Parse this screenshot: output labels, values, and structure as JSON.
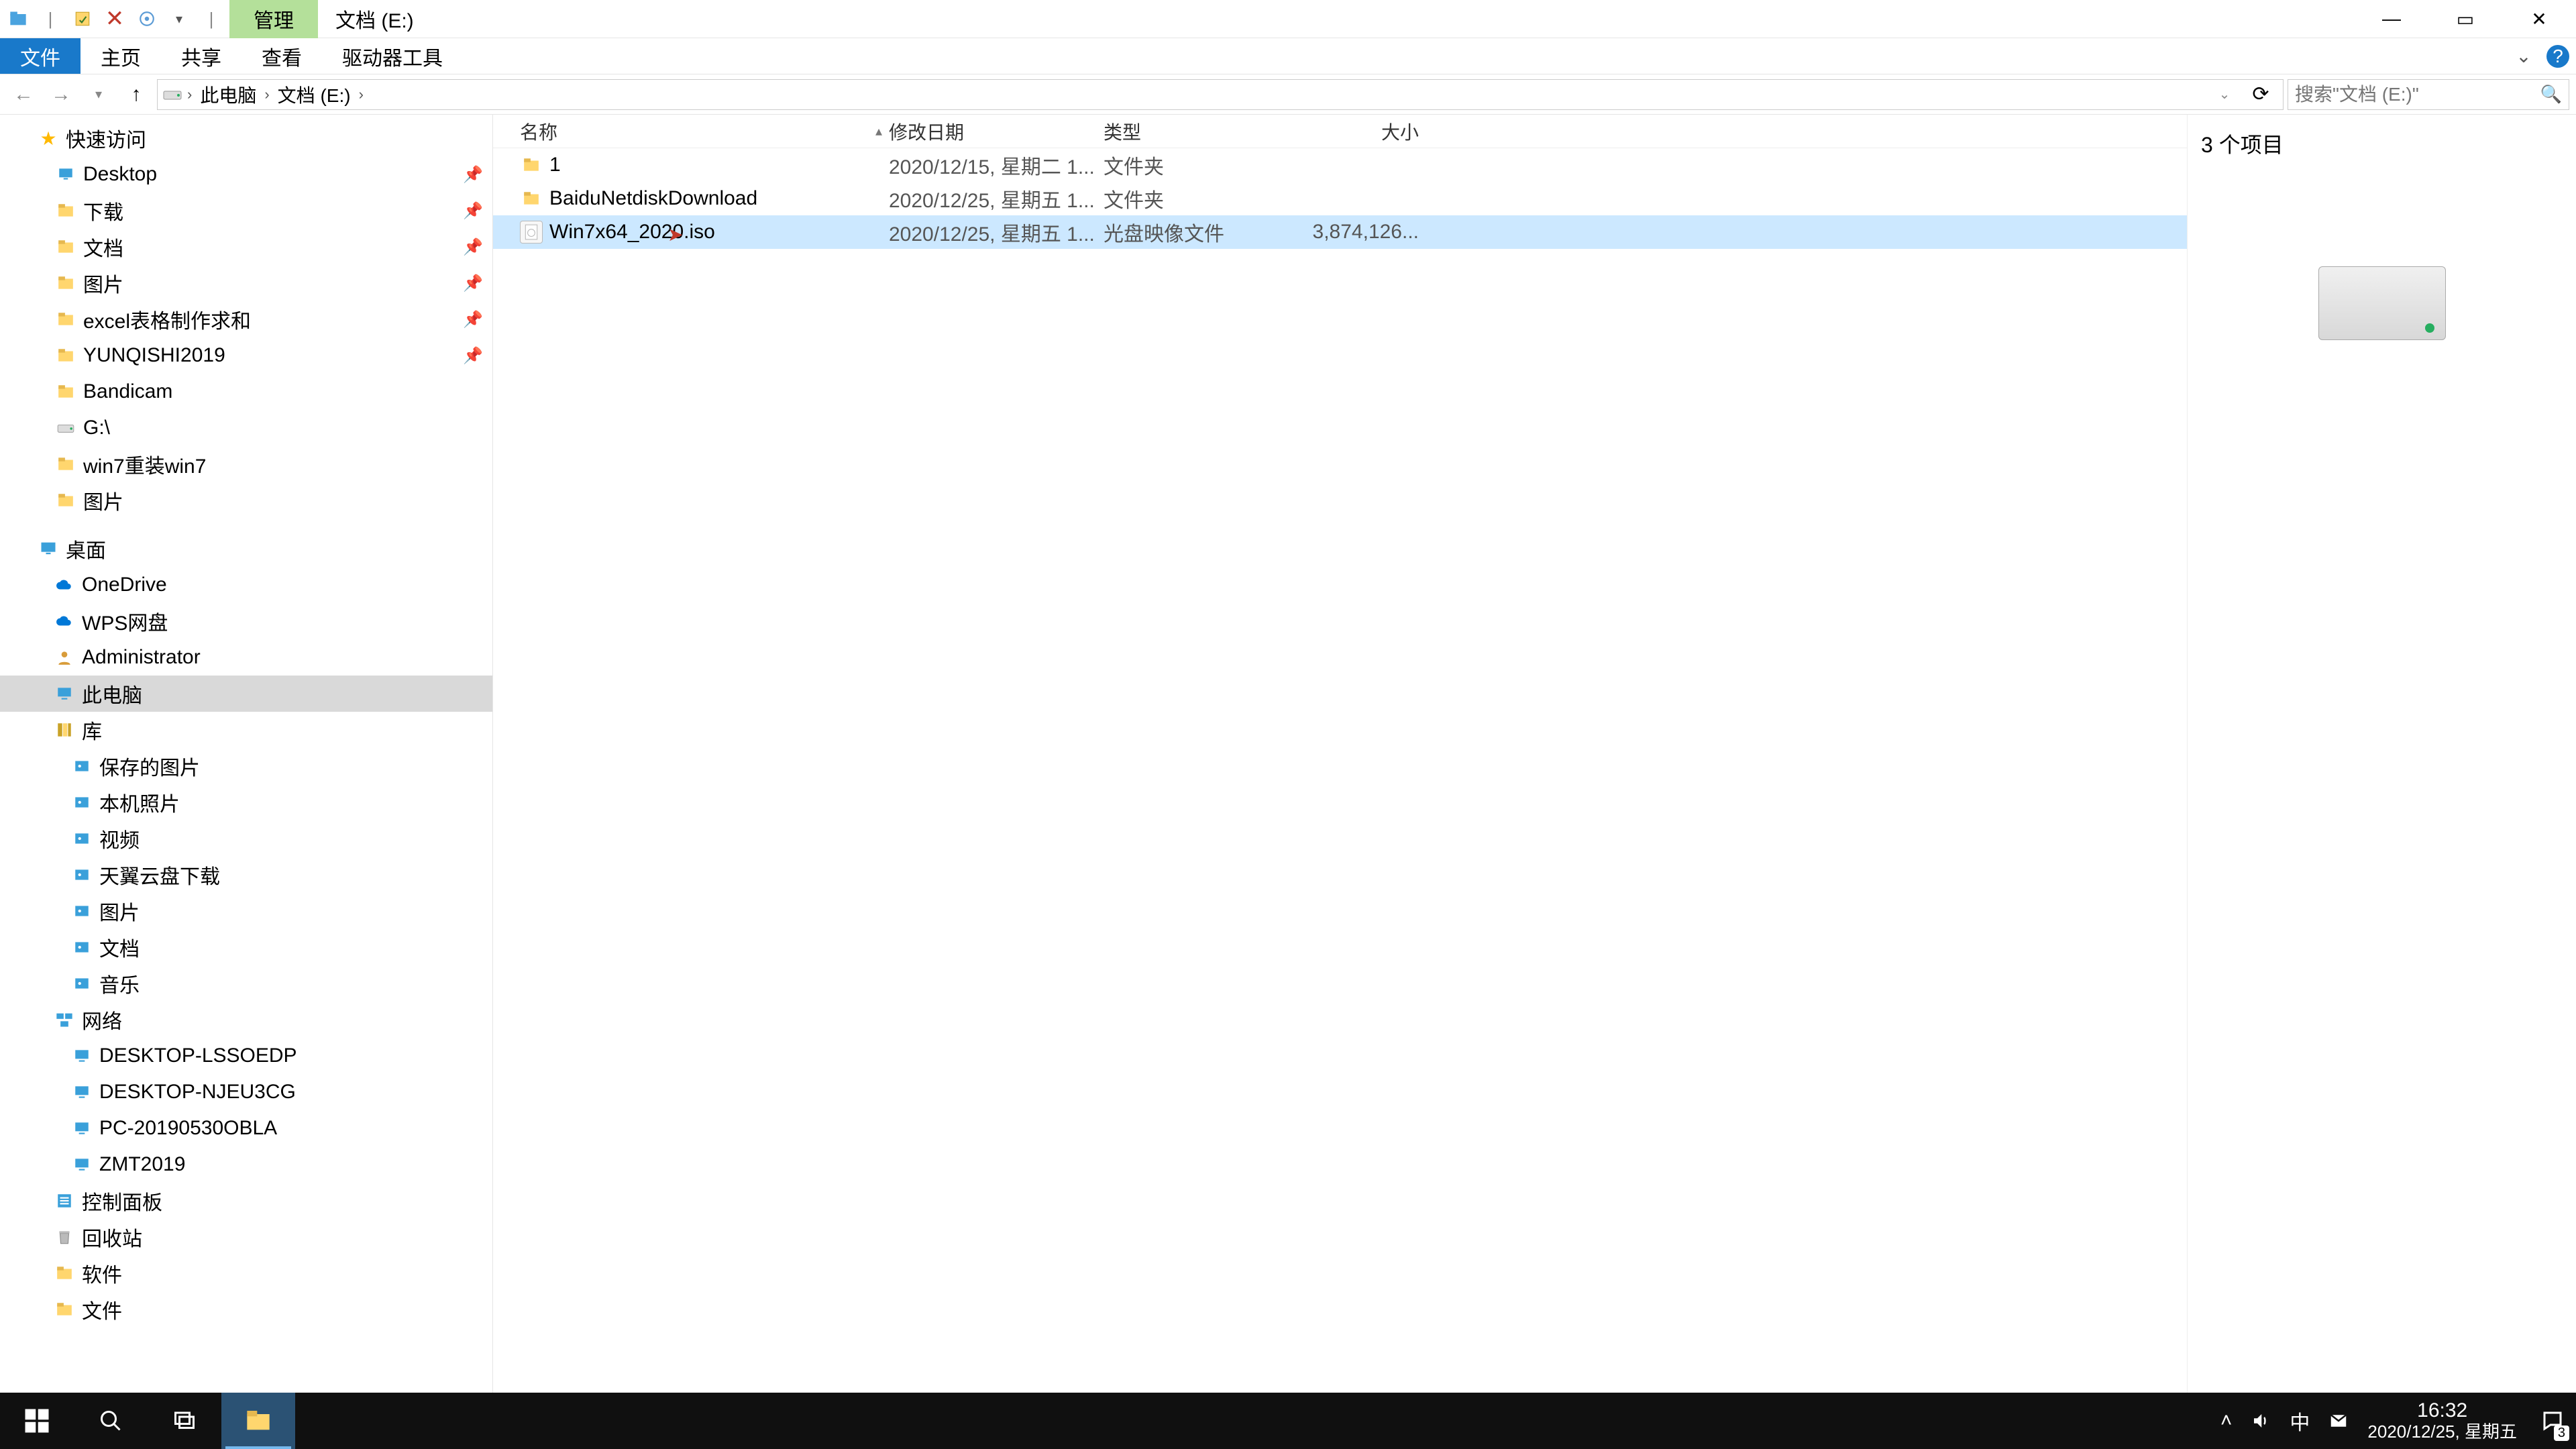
{
  "titlebar": {
    "contextual_tab": "管理",
    "title": "文档 (E:)"
  },
  "win_controls": {
    "min": "—",
    "max": "▭",
    "close": "✕"
  },
  "ribbon": {
    "file": "文件",
    "tabs": [
      "主页",
      "共享",
      "查看",
      "驱动器工具"
    ]
  },
  "addrbar": {
    "segments": [
      "此电脑",
      "文档 (E:)"
    ],
    "search_placeholder": "搜索\"文档 (E:)\""
  },
  "navtree": {
    "quick_access": "快速访问",
    "qa_items": [
      {
        "label": "Desktop",
        "icon": "desktop",
        "pinned": true
      },
      {
        "label": "下载",
        "icon": "folder",
        "pinned": true
      },
      {
        "label": "文档",
        "icon": "folder",
        "pinned": true
      },
      {
        "label": "图片",
        "icon": "folder",
        "pinned": true
      },
      {
        "label": "excel表格制作求和",
        "icon": "folder",
        "pinned": true
      },
      {
        "label": "YUNQISHI2019",
        "icon": "folder",
        "pinned": true
      },
      {
        "label": "Bandicam",
        "icon": "folder",
        "pinned": false
      },
      {
        "label": "G:\\",
        "icon": "drive",
        "pinned": false
      },
      {
        "label": "win7重装win7",
        "icon": "folder",
        "pinned": false
      },
      {
        "label": "图片",
        "icon": "folder",
        "pinned": false
      }
    ],
    "desktop": "桌面",
    "desktop_items": [
      {
        "label": "OneDrive",
        "icon": "cloud"
      },
      {
        "label": "WPS网盘",
        "icon": "cloud"
      },
      {
        "label": "Administrator",
        "icon": "user"
      },
      {
        "label": "此电脑",
        "icon": "pc",
        "selected": true
      },
      {
        "label": "库",
        "icon": "lib"
      }
    ],
    "lib_items": [
      {
        "label": "保存的图片",
        "icon": "media"
      },
      {
        "label": "本机照片",
        "icon": "media"
      },
      {
        "label": "视频",
        "icon": "media"
      },
      {
        "label": "天翼云盘下载",
        "icon": "media"
      },
      {
        "label": "图片",
        "icon": "media"
      },
      {
        "label": "文档",
        "icon": "media"
      },
      {
        "label": "音乐",
        "icon": "media"
      }
    ],
    "network": "网络",
    "net_items": [
      {
        "label": "DESKTOP-LSSOEDP",
        "icon": "pc"
      },
      {
        "label": "DESKTOP-NJEU3CG",
        "icon": "pc"
      },
      {
        "label": "PC-20190530OBLA",
        "icon": "pc"
      },
      {
        "label": "ZMT2019",
        "icon": "pc"
      }
    ],
    "tail_items": [
      {
        "label": "控制面板",
        "icon": "panel"
      },
      {
        "label": "回收站",
        "icon": "trash"
      },
      {
        "label": "软件",
        "icon": "folder"
      },
      {
        "label": "文件",
        "icon": "folder"
      }
    ]
  },
  "columns": {
    "name": "名称",
    "date": "修改日期",
    "type": "类型",
    "size": "大小"
  },
  "rows": [
    {
      "name": "1",
      "date": "2020/12/15, 星期二 1...",
      "type": "文件夹",
      "size": "",
      "icon": "folder",
      "selected": false
    },
    {
      "name": "BaiduNetdiskDownload",
      "date": "2020/12/25, 星期五 1...",
      "type": "文件夹",
      "size": "",
      "icon": "folder",
      "selected": false
    },
    {
      "name": "Win7x64_2020.iso",
      "date": "2020/12/25, 星期五 1...",
      "type": "光盘映像文件",
      "size": "3,874,126...",
      "icon": "iso",
      "selected": true
    }
  ],
  "preview": {
    "summary": "3 个项目"
  },
  "statusbar": {
    "text": "3 个项目"
  },
  "taskbar": {
    "time": "16:32",
    "date": "2020/12/25, 星期五",
    "ime": "中",
    "notif_count": "3"
  }
}
